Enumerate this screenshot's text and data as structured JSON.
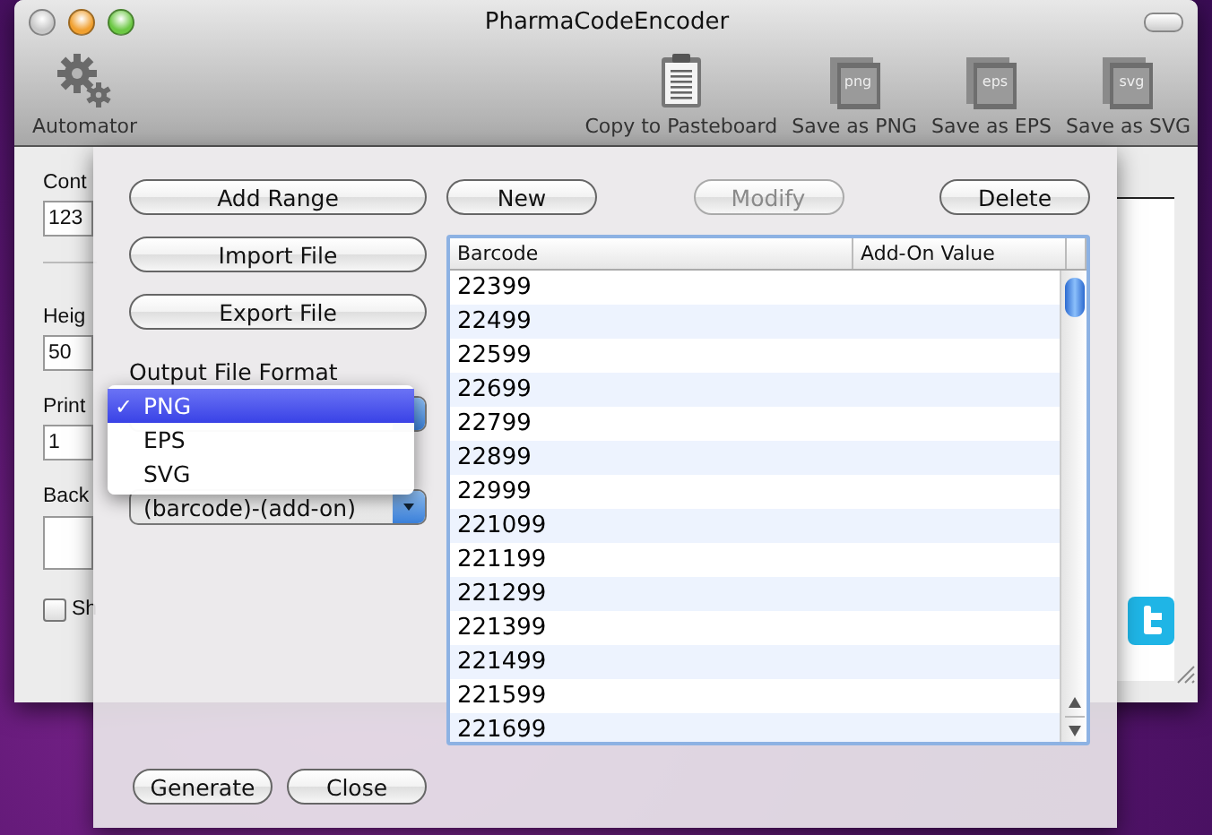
{
  "window": {
    "title": "PharmaCodeEncoder"
  },
  "toolbar": {
    "items": [
      {
        "kind": "gear",
        "label": "Automator"
      },
      {
        "kind": "clipboard",
        "label": "Copy to Pasteboard"
      },
      {
        "kind": "file",
        "label": "Save as PNG",
        "badge": "png"
      },
      {
        "kind": "file",
        "label": "Save as EPS",
        "badge": "eps"
      },
      {
        "kind": "file",
        "label": "Save as SVG",
        "badge": "svg"
      }
    ]
  },
  "form": {
    "fields": [
      {
        "kind": "text",
        "label": "Cont",
        "value": "123"
      },
      {
        "kind": "text",
        "label": "Heig",
        "value": "50"
      },
      {
        "kind": "text",
        "label": "Print",
        "value": "1"
      },
      {
        "kind": "color",
        "label": "Back"
      }
    ],
    "checkbox": {
      "label": "Sh",
      "checked": false
    }
  },
  "sheet": {
    "side_buttons": [
      {
        "label": "Add Range"
      },
      {
        "label": "Import File"
      },
      {
        "label": "Export File"
      }
    ],
    "output_format": {
      "label": "Output File Format",
      "check_mark": "✓",
      "menu": [
        {
          "label": "PNG",
          "selected": true
        },
        {
          "label": "EPS",
          "selected": false
        },
        {
          "label": "SVG",
          "selected": false
        }
      ]
    },
    "filenaming": {
      "value": "(barcode)-(add-on)"
    },
    "list_buttons": [
      {
        "label": "New",
        "disabled": false
      },
      {
        "label": "Modify",
        "disabled": true
      },
      {
        "label": "Delete",
        "disabled": false
      }
    ],
    "table": {
      "columns": [
        "Barcode",
        "Add-On Value"
      ],
      "rows": [
        {
          "barcode": "22399"
        },
        {
          "barcode": "22499"
        },
        {
          "barcode": "22599"
        },
        {
          "barcode": "22699"
        },
        {
          "barcode": "22799"
        },
        {
          "barcode": "22899"
        },
        {
          "barcode": "22999"
        },
        {
          "barcode": "221099"
        },
        {
          "barcode": "221199"
        },
        {
          "barcode": "221299"
        },
        {
          "barcode": "221399"
        },
        {
          "barcode": "221499"
        },
        {
          "barcode": "221599"
        },
        {
          "barcode": "221699"
        }
      ]
    },
    "footer_buttons": [
      {
        "label": "Generate"
      },
      {
        "label": "Close"
      }
    ]
  }
}
